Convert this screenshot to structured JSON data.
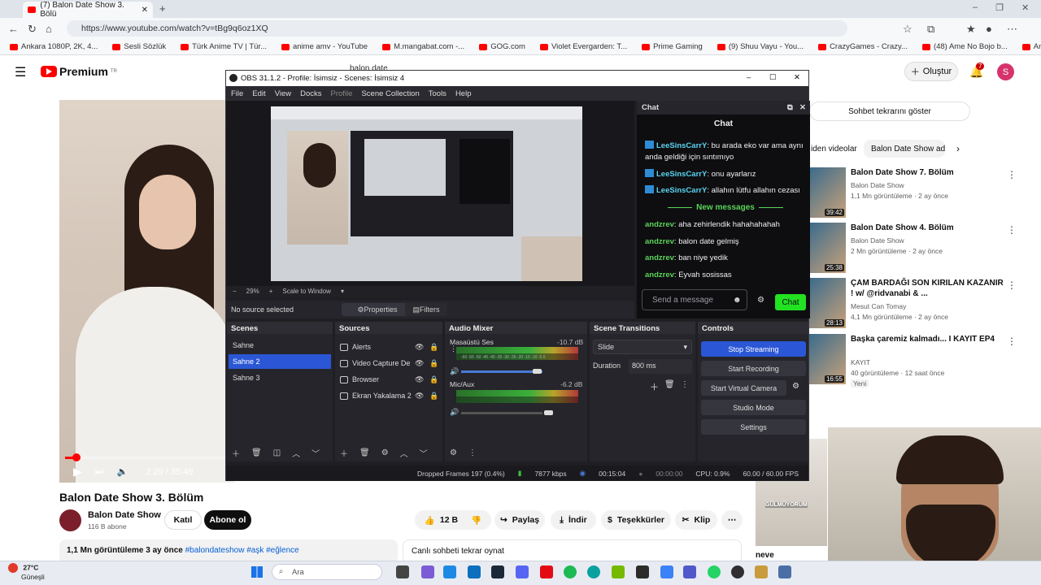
{
  "browser": {
    "tab_title": "(7) Balon Date Show 3. Bölü",
    "url": "https://www.youtube.com/watch?v=tBg9q6oz1XQ",
    "bookmarks": [
      "Ankara 1080P, 2K, 4...",
      "Sesli Sözlük",
      "Türk Anime TV | Tür...",
      "anime amv - YouTube",
      "M.mangabat.com -...",
      "GOG.com",
      "Violet Evergarden: T...",
      "Prime Gaming",
      "(9) Shuu Vayu - You...",
      "CrazyGames - Crazy...",
      "(48) Ame No Bojo b...",
      "Anime izle | Türk ani..."
    ]
  },
  "youtube": {
    "logo_text": "Premium",
    "logo_sup": "TR",
    "create_label": "Oluştur",
    "notif_count": "7",
    "avatar_letter": "S",
    "search_value": "balon date",
    "time": "2:29 / 35:49",
    "progress": 0.07,
    "video_title": "Balon Date Show 3. Bölüm",
    "channel_name": "Balon Date Show",
    "channel_subs": "116 B abone",
    "join_label": "Katıl",
    "subscribe_label": "Abone ol",
    "likes": "12 B",
    "share_label": "Paylaş",
    "download_label": "İndir",
    "thanks_label": "Teşekkürler",
    "clip_label": "Klip",
    "views_line": "1,1 Mn görüntüleme  3 ay önce",
    "tags": "#balondateshow #aşk #eğlence",
    "chat_replay_bottom": "Canlı sohbeti tekrar oynat",
    "chat_replay_top": "Sohbet tekrarını göster",
    "chips": [
      "iden videolar",
      "Balon Date Show adl"
    ],
    "side_thumb_text": "GÜLMÜYORUM",
    "side_title_partial": "neve",
    "recommendations": [
      {
        "title": "Balon Date Show 7. Bölüm",
        "channel": "Balon Date Show",
        "meta": "1,1 Mn görüntüleme · 2 ay önce",
        "duration": "39:42"
      },
      {
        "title": "Balon Date Show 4. Bölüm",
        "channel": "Balon Date Show",
        "meta": "2 Mn görüntüleme · 2 ay önce",
        "duration": "25:38"
      },
      {
        "title": "ÇAM BARDAĞI SON KIRILAN KAZANIR ! w/ @ridvanabi & ...",
        "channel": "Mesut Can Tomay",
        "meta": "4,1 Mn görüntüleme · 2 ay önce",
        "duration": "28:13"
      },
      {
        "title": "Başka çaremiz kalmadı... I KAYIT EP4",
        "channel": "KAYIT",
        "meta": "40 görüntüleme · 12 saat önce",
        "duration": "16:55",
        "badge": "Yeni"
      }
    ]
  },
  "obs": {
    "title": "OBS 31.1.2 - Profile: İsimsiz - Scenes: İsimsiz 4",
    "menu": [
      "File",
      "Edit",
      "View",
      "Docks",
      "Profile",
      "Scene Collection",
      "Tools",
      "Help"
    ],
    "zoom": "29%",
    "scale_mode": "Scale to Window",
    "no_source": "No source selected",
    "properties_label": "Properties",
    "filters_label": "Filters",
    "docks": {
      "scenes": "Scenes",
      "sources": "Sources",
      "mixer": "Audio Mixer",
      "transitions": "Scene Transitions",
      "controls": "Controls"
    },
    "scenes": [
      "Sahne",
      "Sahne 2",
      "Sahne 3"
    ],
    "sources": [
      "Alerts",
      "Video Capture De",
      "Browser",
      "Ekran Yakalama 2"
    ],
    "mixer": [
      {
        "name": "Masaüstü Ses",
        "db": "-10.7 dB",
        "scale": "-60 -55 -50 -45 -40 -35 -30 -25 -20 -15 -10 -5 0",
        "level": 0.62
      },
      {
        "name": "Mic/Aux",
        "db": "-6.2 dB",
        "scale": "-60 -55 -50 -45 -40 -35 -30 -25 -20 -15 -10 -5 0",
        "level": 0.72
      }
    ],
    "transition": "Slide",
    "duration_label": "Duration",
    "duration_value": "800 ms",
    "controls": [
      "Stop Streaming",
      "Start Recording",
      "Start Virtual Camera",
      "Studio Mode",
      "Settings"
    ],
    "status": {
      "dropped": "Dropped Frames 197 (0.4%)",
      "kbps": "7877 kbps",
      "stream_time": "00:15:04",
      "rec_time": "00:00:00",
      "cpu": "CPU: 0.9%",
      "fps": "60.00 / 60.00 FPS"
    },
    "chat": {
      "dock_title": "Chat",
      "heading": "Chat",
      "new_messages": "New messages",
      "input_placeholder": "Send a message",
      "send_label": "Chat",
      "messages": [
        {
          "user": "LeeSinsCarrY",
          "text": "bu arada eko var ama aynı anda geldiği için sıntımıyo",
          "badge": true
        },
        {
          "user": "LeeSinsCarrY",
          "text": "onu ayarlarız",
          "badge": true
        },
        {
          "user": "LeeSinsCarrY",
          "text": "allahın lütfu allahın cezası",
          "badge": true
        },
        {
          "user": "andzrev",
          "text": "aha zehirlendik hahahahahah"
        },
        {
          "user": "andzrev",
          "text": "balon date gelmiş"
        },
        {
          "user": "andzrev",
          "text": "ban niye yedik"
        },
        {
          "user": "andzrev",
          "text": "Eyvah sosissas"
        }
      ]
    }
  },
  "taskbar": {
    "temp": "27°C",
    "location": "Güneşli",
    "search": "Ara"
  },
  "colors": {
    "obs_bg": "#1f1f23",
    "obs_accent": "#2b57d6",
    "chat_send": "#22e222",
    "youtube_red": "#ff0000"
  }
}
